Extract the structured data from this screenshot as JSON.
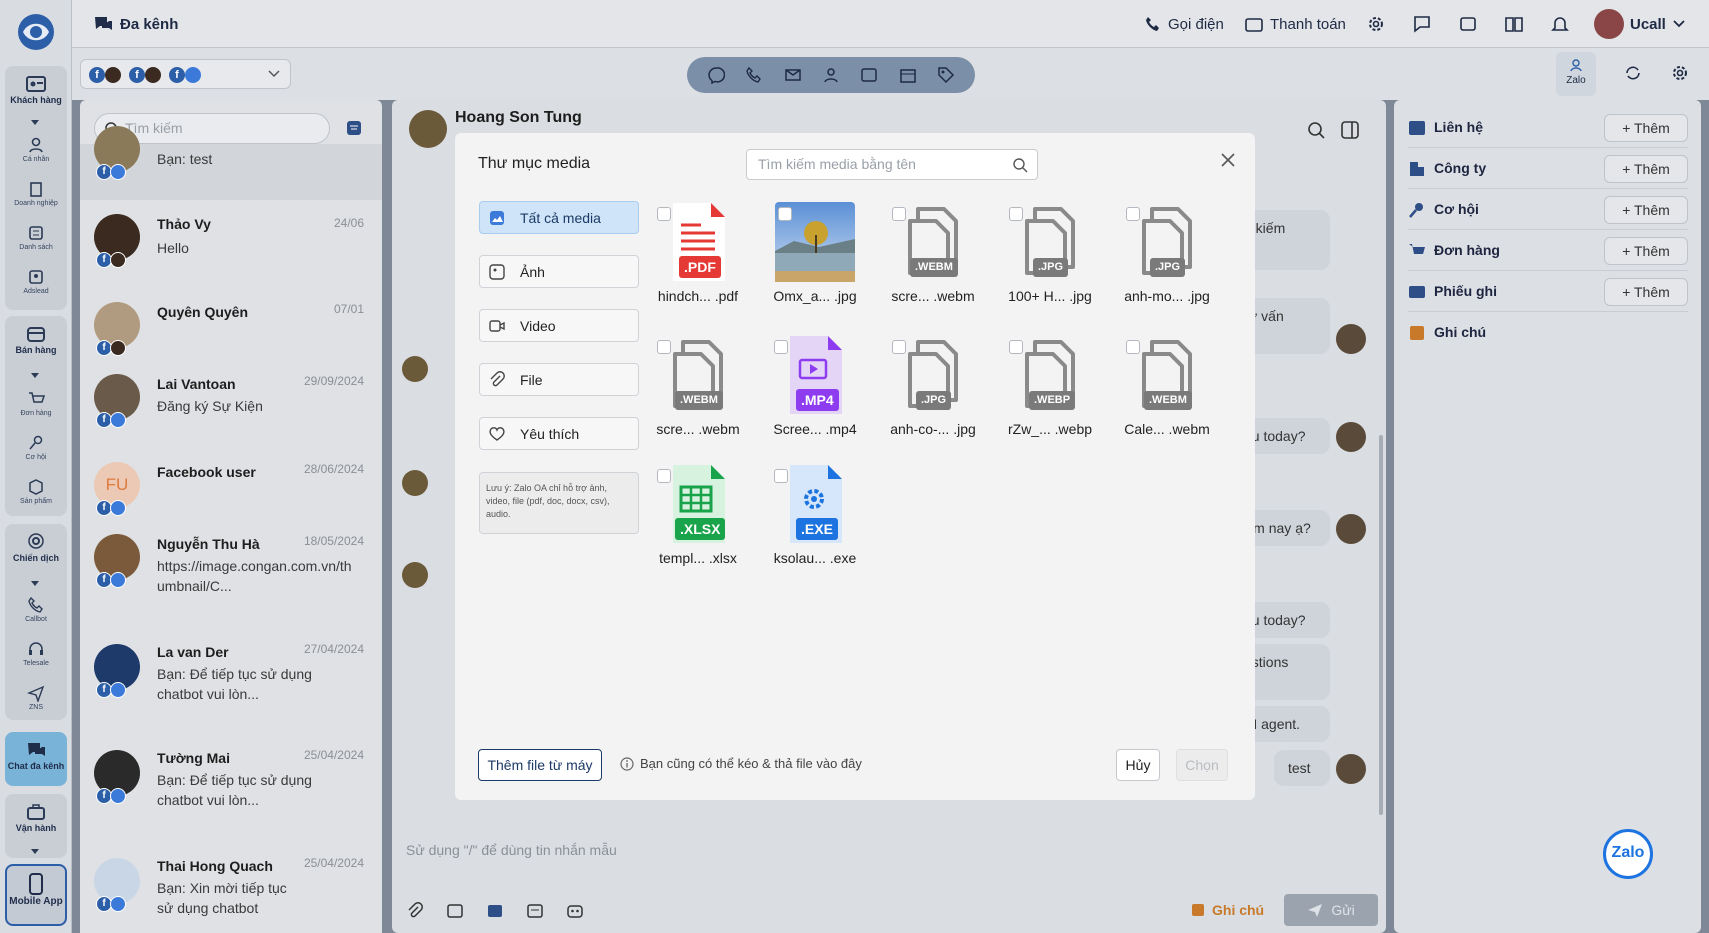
{
  "colors": {
    "accent": "#1d74e0",
    "active_nav": "#7ab3d8",
    "cat_active": "#cfe4f8"
  },
  "nav": {
    "customers": "Khách hàng",
    "personal": "Cá nhân",
    "business": "Doanh nghiệp",
    "lists": "Danh sách",
    "adslead": "Adslead",
    "sales": "Bán hàng",
    "orders": "Đơn hàng",
    "opportunities": "Cơ hội",
    "products": "Sản phẩm",
    "campaigns": "Chiến dịch",
    "callbot": "Callbot",
    "telesale": "Telesale",
    "zns": "ZNS",
    "multichannel": "Chat đa kênh",
    "operations": "Vận hành",
    "mobile": "Mobile App"
  },
  "header": {
    "title": "Đa kênh",
    "call": "Gọi điện",
    "payment": "Thanh toán",
    "user": "Ucall"
  },
  "sub": {
    "zalo_label": "Zalo"
  },
  "contacts": {
    "search_placeholder": "Tìm kiếm",
    "items": [
      {
        "name": "",
        "date": "",
        "msg": "Bạn: test"
      },
      {
        "name": "Thảo Vy",
        "date": "24/06",
        "msg": "Hello"
      },
      {
        "name": "Quyên Quyên",
        "date": "07/01",
        "msg": ""
      },
      {
        "name": "Lai Vantoan",
        "date": "29/09/2024",
        "msg": "Đăng ký Sự Kiện"
      },
      {
        "name": "Facebook user",
        "date": "28/06/2024",
        "msg": "",
        "initials": "FU"
      },
      {
        "name": "Nguyễn Thu Hà",
        "date": "18/05/2024",
        "msg": "https://image.congan.com.vn/thumbnail/C..."
      },
      {
        "name": "La van Der",
        "date": "27/04/2024",
        "msg": "Bạn: Để tiếp tục sử dụng chatbot vui lòn..."
      },
      {
        "name": "Tường Mai",
        "date": "25/04/2024",
        "msg": "Bạn: Để tiếp tục sử dụng chatbot vui lòn..."
      },
      {
        "name": "Thai Hong Quach",
        "date": "25/04/2024",
        "msg": "Bạn: Xin mời tiếp tục sử dụng chatbot"
      }
    ]
  },
  "chat": {
    "contact_name": "Hoang Son Tung",
    "bubbles": [
      "ể kiếm",
      "tư vấn",
      "ou today?",
      "ơm nay ạ?",
      "ou today?",
      "estions",
      "AI agent.",
      "test"
    ],
    "input_placeholder": "Sử dụng \"/\" để dùng tin nhắn mẫu",
    "note_btn": "Ghi chú",
    "send_btn": "Gửi"
  },
  "right": {
    "add_label": "Thêm",
    "rows": [
      "Liên hệ",
      "Công ty",
      "Cơ hội",
      "Đơn hàng",
      "Phiếu ghi",
      "Ghi chú"
    ]
  },
  "modal": {
    "title": "Thư mục media",
    "search_placeholder": "Tìm kiếm media bằng tên",
    "categories": [
      "Tất cả media",
      "Ảnh",
      "Video",
      "File",
      "Yêu thích"
    ],
    "note": "Lưu ý: Zalo OA chỉ hỗ trợ ảnh, video, file (pdf, doc, docx, csv), audio.",
    "files": [
      {
        "name": "hindch... .pdf",
        "tag": ".PDF",
        "kind": "pdf"
      },
      {
        "name": "Omx_a... .jpg",
        "tag": "",
        "kind": "photo"
      },
      {
        "name": "scre... .webm",
        "tag": ".WEBM",
        "kind": "generic"
      },
      {
        "name": "100+ H... .jpg",
        "tag": ".JPG",
        "kind": "generic"
      },
      {
        "name": "anh-mo... .jpg",
        "tag": ".JPG",
        "kind": "generic"
      },
      {
        "name": "scre... .webm",
        "tag": ".WEBM",
        "kind": "generic"
      },
      {
        "name": "Scree... .mp4",
        "tag": ".MP4",
        "kind": "mp4"
      },
      {
        "name": "anh-co-... .jpg",
        "tag": ".JPG",
        "kind": "generic"
      },
      {
        "name": "rZw_... .webp",
        "tag": ".WEBP",
        "kind": "generic"
      },
      {
        "name": "Cale... .webm",
        "tag": ".WEBM",
        "kind": "generic"
      },
      {
        "name": "templ... .xlsx",
        "tag": ".XLSX",
        "kind": "xlsx"
      },
      {
        "name": "ksolau... .exe",
        "tag": ".EXE",
        "kind": "exe"
      }
    ],
    "add_file_btn": "Thêm file từ máy",
    "drop_hint": "Bạn cũng có thể kéo & thả file vào đây",
    "cancel_btn": "Hủy",
    "choose_btn": "Chọn"
  },
  "fab": {
    "label": "Zalo"
  }
}
